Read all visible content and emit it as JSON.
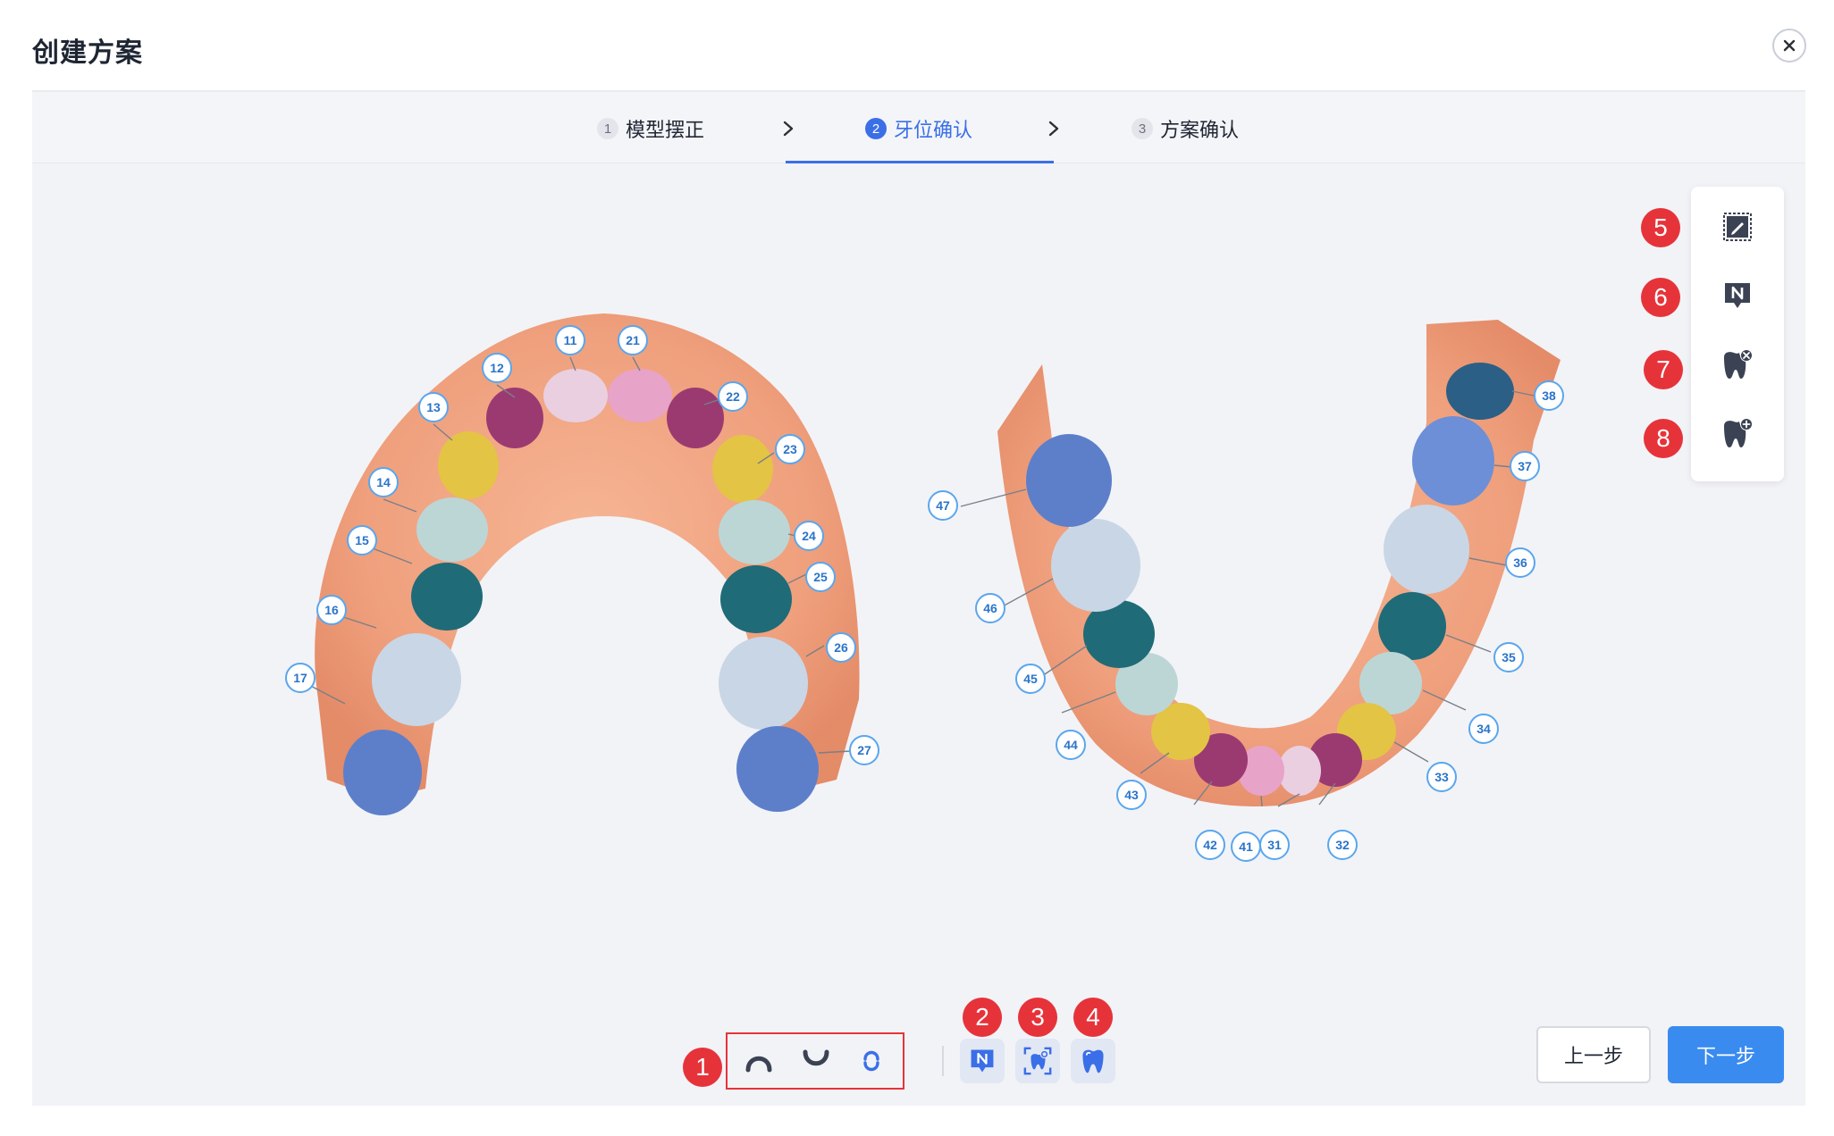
{
  "dialog": {
    "title": "创建方案",
    "close_icon": "close-icon"
  },
  "steps": [
    {
      "num": "1",
      "label": "模型摆正",
      "active": false
    },
    {
      "num": "2",
      "label": "牙位确认",
      "active": true
    },
    {
      "num": "3",
      "label": "方案确认",
      "active": false
    }
  ],
  "upper_teeth": [
    "11",
    "12",
    "13",
    "14",
    "15",
    "16",
    "17",
    "21",
    "22",
    "23",
    "24",
    "25",
    "26",
    "27"
  ],
  "lower_teeth": [
    "31",
    "32",
    "33",
    "34",
    "35",
    "36",
    "37",
    "38",
    "41",
    "42",
    "43",
    "44",
    "45",
    "46",
    "47"
  ],
  "markers": [
    "1",
    "2",
    "3",
    "4",
    "5",
    "6",
    "7",
    "8"
  ],
  "bottom_tools": {
    "view_icons": [
      "upper-jaw-icon",
      "lower-jaw-icon",
      "both-jaws-icon"
    ],
    "other_icons": [
      "tooth-number-icon",
      "tooth-view-icon",
      "tooth-icon"
    ]
  },
  "right_panel_icons": [
    "edit-segmentation-icon",
    "tooth-number-icon",
    "remove-tooth-icon",
    "add-tooth-icon"
  ],
  "footer": {
    "prev_label": "上一步",
    "next_label": "下一步"
  },
  "colors": {
    "accent": "#3a6fe8",
    "next_button": "#3a8bf0",
    "marker": "#e6333a",
    "gum": "#f0a080"
  }
}
